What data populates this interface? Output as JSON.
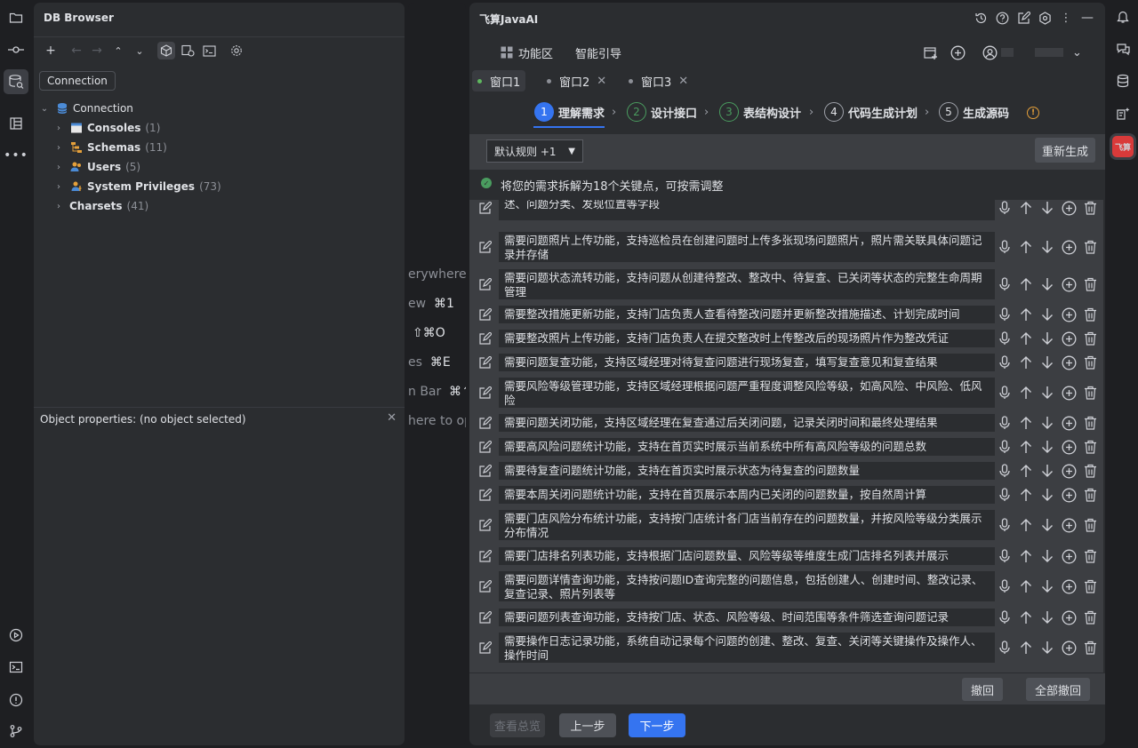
{
  "db_browser": {
    "title": "DB Browser",
    "tooltip": "Connection",
    "tree": [
      {
        "label": "Connection",
        "count": "",
        "bold": false
      },
      {
        "label": "Consoles",
        "count": "(1)",
        "bold": true
      },
      {
        "label": "Schemas",
        "count": "(11)",
        "bold": true
      },
      {
        "label": "Users",
        "count": "(5)",
        "bold": true
      },
      {
        "label": "System Privileges",
        "count": "(73)",
        "bold": true
      },
      {
        "label": "Charsets",
        "count": "(41)",
        "bold": true
      }
    ],
    "object_properties": "Object properties:   (no object selected)"
  },
  "editor_hints": [
    {
      "text": "erywhere",
      "shortcut": ""
    },
    {
      "text": "ew",
      "shortcut": "⌘1"
    },
    {
      "text": "",
      "shortcut": "⇧⌘O"
    },
    {
      "text": "es",
      "shortcut": "⌘E"
    },
    {
      "text": "n Bar",
      "shortcut": "⌘↑"
    },
    {
      "text": "here to op",
      "shortcut": ""
    }
  ],
  "ai_panel": {
    "title": "飞算JavaAI",
    "menu": {
      "features": "功能区",
      "guide": "智能引导"
    },
    "tabs": [
      {
        "label": "窗口1",
        "active": true,
        "closable": false
      },
      {
        "label": "窗口2",
        "active": false,
        "closable": true
      },
      {
        "label": "窗口3",
        "active": false,
        "closable": true
      }
    ],
    "steps": [
      {
        "num": "1",
        "label": "理解需求",
        "state": "current"
      },
      {
        "num": "2",
        "label": "设计接口",
        "state": "done"
      },
      {
        "num": "3",
        "label": "表结构设计",
        "state": "done"
      },
      {
        "num": "4",
        "label": "代码生成计划",
        "state": "todo"
      },
      {
        "num": "5",
        "label": "生成源码",
        "state": "todo"
      }
    ],
    "rule_select": "默认规则 +1",
    "regenerate": "重新生成",
    "info": "将您的需求拆解为18个关键点，可按需调整",
    "items": [
      "述、问题分类、发现位置等字段",
      "需要问题照片上传功能，支持巡检员在创建问题时上传多张现场问题照片，照片需关联具体问题记录并存储",
      "需要问题状态流转功能，支持问题从创建待整改、整改中、待复查、已关闭等状态的完整生命周期管理",
      "需要整改措施更新功能，支持门店负责人查看待整改问题并更新整改措施描述、计划完成时间",
      "需要整改照片上传功能，支持门店负责人在提交整改时上传整改后的现场照片作为整改凭证",
      "需要问题复查功能，支持区域经理对待复查问题进行现场复查，填写复查意见和复查结果",
      "需要风险等级管理功能，支持区域经理根据问题严重程度调整风险等级，如高风险、中风险、低风险",
      "需要问题关闭功能，支持区域经理在复查通过后关闭问题，记录关闭时间和最终处理结果",
      "需要高风险问题统计功能，支持在首页实时展示当前系统中所有高风险等级的问题总数",
      "需要待复查问题统计功能，支持在首页实时展示状态为待复查的问题数量",
      "需要本周关闭问题统计功能，支持在首页展示本周内已关闭的问题数量，按自然周计算",
      "需要门店风险分布统计功能，支持按门店统计各门店当前存在的问题数量，并按风险等级分类展示分布情况",
      "需要门店排名列表功能，支持根据门店问题数量、风险等级等维度生成门店排名列表并展示",
      "需要问题详情查询功能，支持按问题ID查询完整的问题信息，包括创建人、创建时间、整改记录、复查记录、照片列表等",
      "需要问题列表查询功能，支持按门店、状态、风险等级、时间范围等条件筛选查询问题记录",
      "需要操作日志记录功能，系统自动记录每个问题的创建、整改、复查、关闭等关键操作及操作人、操作时间"
    ],
    "undo": "撤回",
    "undo_all": "全部撤回",
    "overview": "查看总览",
    "prev": "上一步",
    "next": "下一步"
  },
  "icons": {
    "left_strip": [
      "folder-icon",
      "commit-icon",
      "db-browser-icon",
      "structure-icon",
      "more-icon",
      "run-icon",
      "terminal-icon",
      "problems-icon",
      "git-icon"
    ],
    "right_strip": [
      "notifications-icon",
      "ai-chat-icon",
      "database-icon",
      "ai-assistant-icon",
      "feisuan-icon"
    ]
  },
  "colors": {
    "accent": "#3574f0",
    "success": "#4a9c5f",
    "warning": "#e5a03a",
    "brand": "#d93a3a"
  }
}
